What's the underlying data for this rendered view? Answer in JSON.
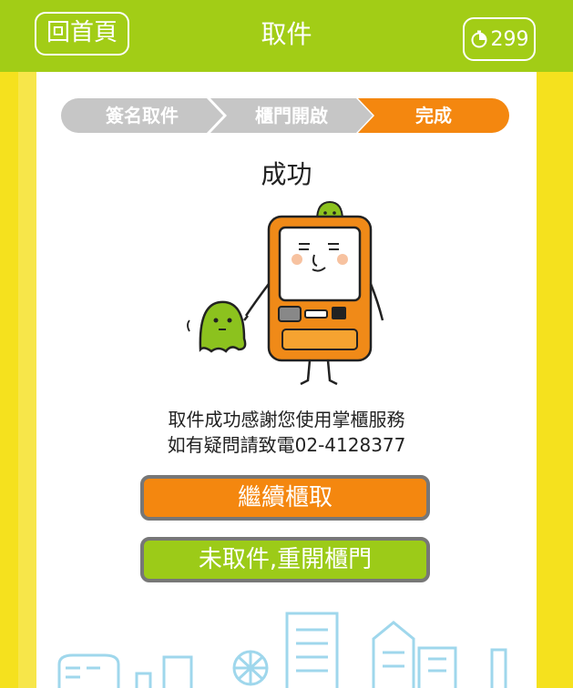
{
  "header": {
    "home_label": "回首頁",
    "title": "取件",
    "timer_value": "299",
    "timer_icon": "timer-icon"
  },
  "steps": [
    {
      "label": "簽名取件",
      "active": false
    },
    {
      "label": "櫃門開啟",
      "active": false
    },
    {
      "label": "完成",
      "active": true
    }
  ],
  "result": {
    "title": "成功",
    "message_line1": "取件成功感謝您使用掌櫃服務",
    "message_line2": "如有疑問請致電02-4128377"
  },
  "buttons": {
    "continue_label": "繼續櫃取",
    "reopen_label": "未取件,重開櫃門"
  },
  "colors": {
    "header": "#a2cd16",
    "accent_orange": "#f4870f",
    "accent_green": "#9ccb18",
    "background_yellow": "#f7e64a",
    "step_inactive": "#c6c6c6"
  }
}
